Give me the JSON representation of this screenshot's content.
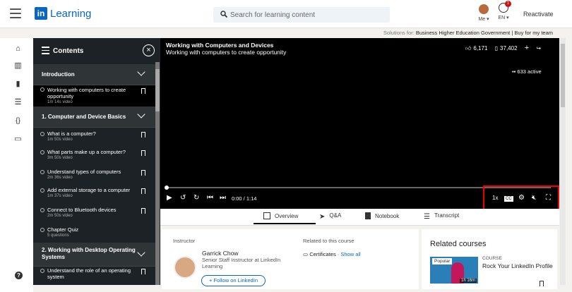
{
  "header": {
    "logo_mark": "in",
    "logo_text": "Learning",
    "search_placeholder": "Search for learning content",
    "me_label": "Me ▾",
    "lang_label": "EN ▾",
    "notif_count": "1",
    "reactivate": "Reactivate"
  },
  "subbar": {
    "prefix": "Solutions for:",
    "links": [
      "Business",
      "Higher Education",
      "Government",
      "Buy for my team"
    ]
  },
  "rail": {
    "icons": [
      "home-icon",
      "collection-icon",
      "bookmark-icon",
      "list-icon",
      "code-icon",
      "certificate-icon"
    ],
    "help": "?"
  },
  "contents": {
    "title": "Contents",
    "sections": [
      {
        "label": "Introduction",
        "items": [
          {
            "title": "Working with computers to create opportunity",
            "meta": "1m 14s video",
            "active": true
          }
        ]
      },
      {
        "label": "1. Computer and Device Basics",
        "items": [
          {
            "title": "What is a computer?",
            "meta": "1m 50s video"
          },
          {
            "title": "What parts make up a computer?",
            "meta": "3m 50s video"
          },
          {
            "title": "Understand types of computers",
            "meta": "2m 36s video"
          },
          {
            "title": "Add external storage to a computer",
            "meta": "1m 37s video"
          },
          {
            "title": "Connect to Bluetooth devices",
            "meta": "2m 50s video"
          },
          {
            "title": "Chapter Quiz",
            "meta": "5 questions"
          }
        ]
      },
      {
        "label": "2. Working with Desktop Operating Systems",
        "items": [
          {
            "title": "Understand the role of an operating system",
            "meta": ""
          }
        ]
      }
    ]
  },
  "video": {
    "course_title": "Working with Computers and Devices",
    "video_title": "Working with computers to create opportunity",
    "likes": "6,171",
    "saves": "37,402",
    "active_viewers": "633 active",
    "time": "0:00 / 1:14",
    "progress": 0,
    "speed": "1x",
    "cc": "CC"
  },
  "tabs": [
    "Overview",
    "Q&A",
    "Notebook",
    "Transcript"
  ],
  "instructor": {
    "heading": "Instructor",
    "name": "Garrick Chow",
    "role": "Senior Staff Instructor at LinkedIn Learning",
    "follow": "+ Follow on LinkedIn"
  },
  "related": {
    "heading": "Related to this course",
    "certificates": "Certificates",
    "show_all": "Show all"
  },
  "related_courses": {
    "heading": "Related courses",
    "badge": "Popular",
    "duration": "1h 16m",
    "kind": "COURSE",
    "name": "Rock Your LinkedIn Profile"
  }
}
